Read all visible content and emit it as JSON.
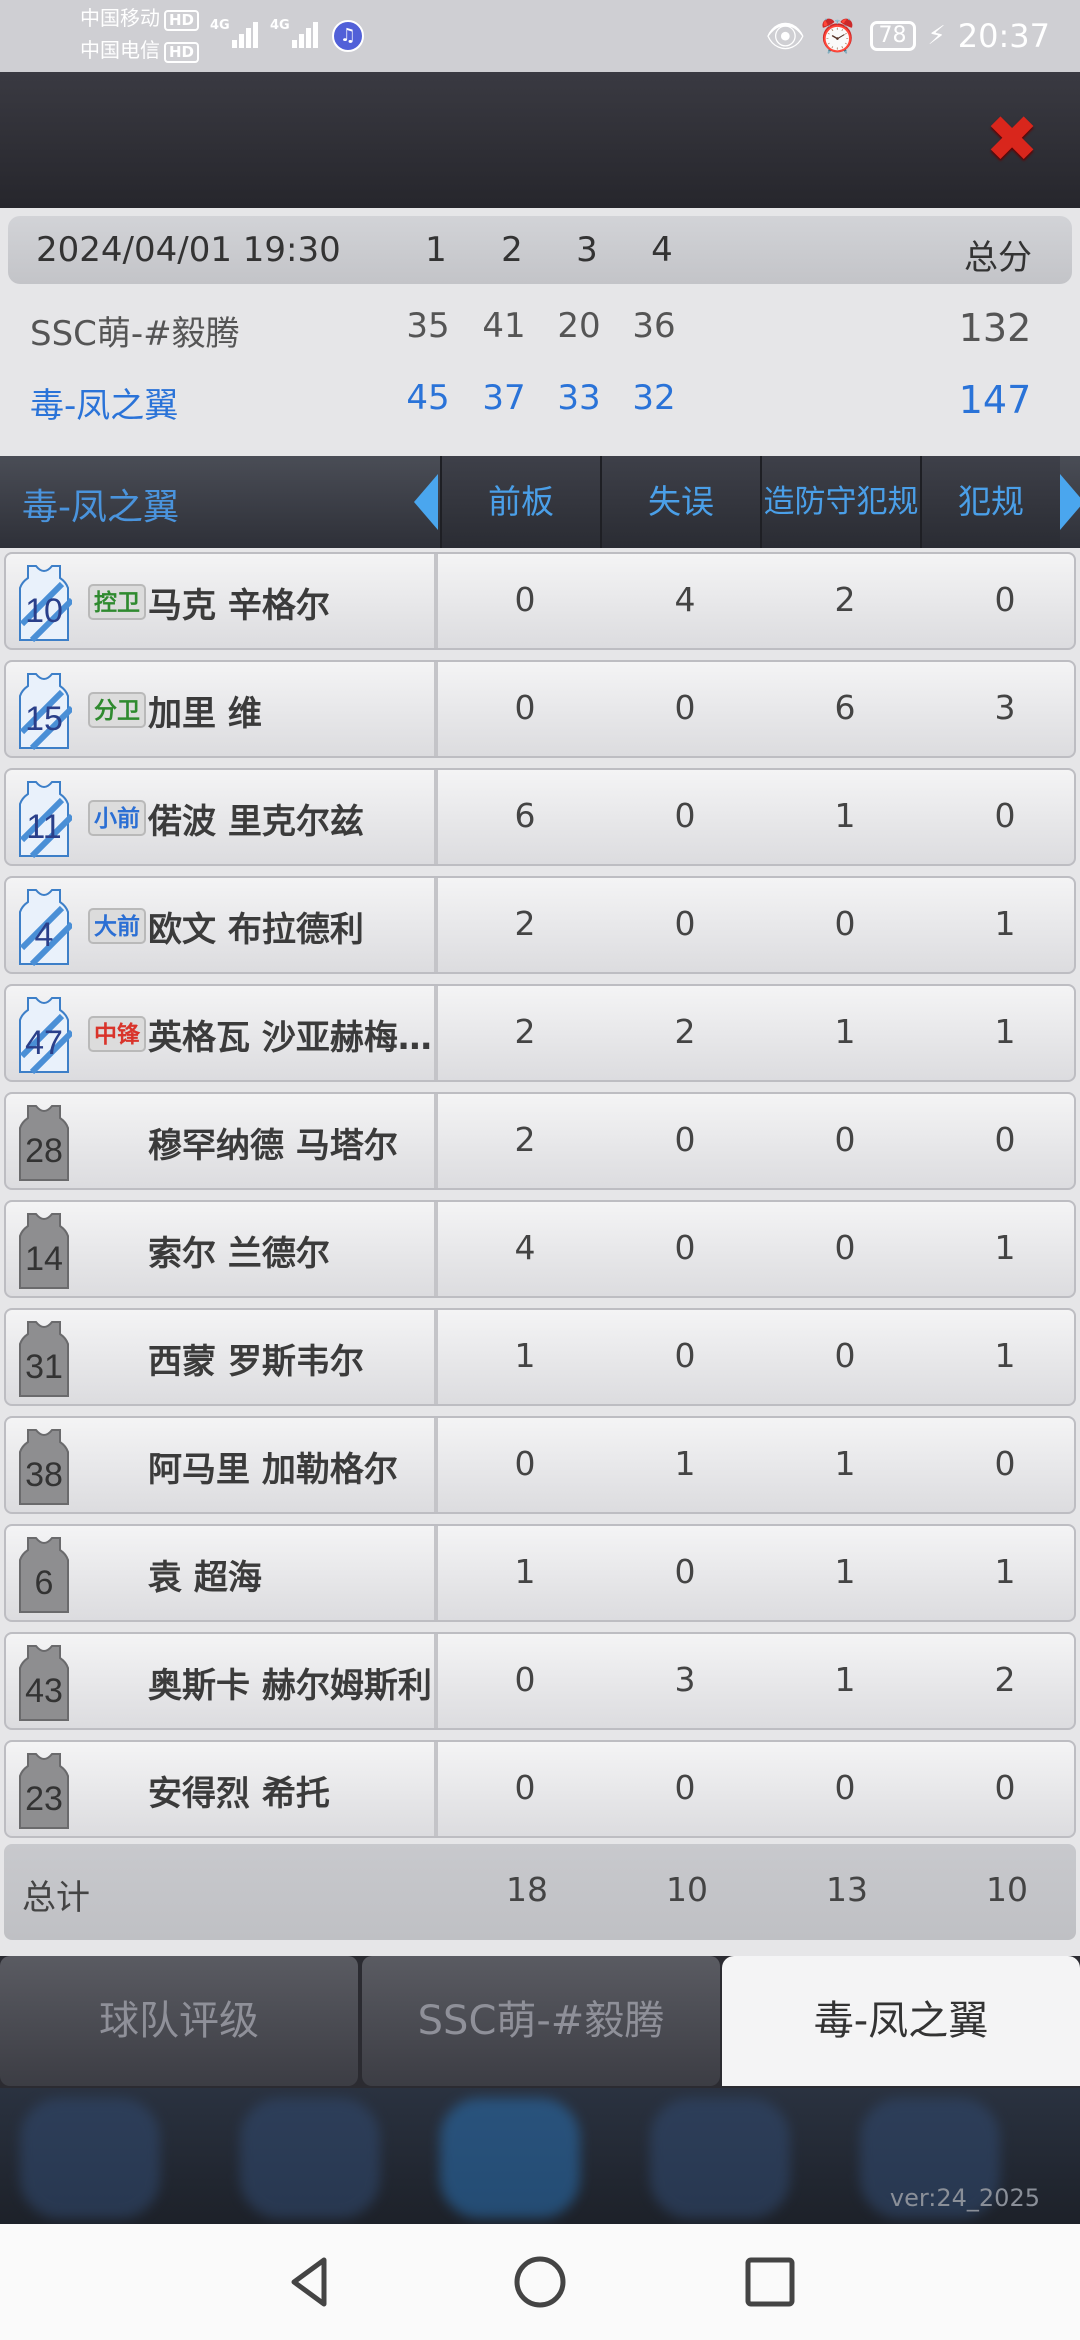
{
  "status": {
    "carrier1": "中国移动",
    "carrier2": "中国电信",
    "hd": "HD",
    "net": "4G",
    "battery": "78",
    "time": "20:37"
  },
  "score": {
    "datetime": "2024/04/01 19:30",
    "quarters": [
      "1",
      "2",
      "3",
      "4"
    ],
    "total_label": "总分",
    "teams": [
      {
        "name": "SSC萌-#毅腾",
        "q": [
          "35",
          "41",
          "20",
          "36"
        ],
        "total": "132",
        "color": "#555555"
      },
      {
        "name": "毒-凤之翼",
        "q": [
          "45",
          "37",
          "33",
          "32"
        ],
        "total": "147",
        "color": "#2a73d8"
      }
    ]
  },
  "stats": {
    "team_name": "毒-凤之翼",
    "columns": [
      "前板",
      "失误",
      "造防守犯规",
      "犯规"
    ],
    "players": [
      {
        "number": "10",
        "pos": "控卫",
        "pos_color": "#2f8a2f",
        "name": "马克 辛格尔",
        "starter": true,
        "vals": [
          "0",
          "4",
          "2",
          "0"
        ]
      },
      {
        "number": "15",
        "pos": "分卫",
        "pos_color": "#2f8a2f",
        "name": "加里 维",
        "starter": true,
        "vals": [
          "0",
          "0",
          "6",
          "3"
        ]
      },
      {
        "number": "11",
        "pos": "小前",
        "pos_color": "#2b6fd4",
        "name": "偌波 里克尔兹",
        "starter": true,
        "vals": [
          "6",
          "0",
          "1",
          "0"
        ]
      },
      {
        "number": "4",
        "pos": "大前",
        "pos_color": "#2b6fd4",
        "name": "欧文 布拉德利",
        "starter": true,
        "vals": [
          "2",
          "0",
          "0",
          "1"
        ]
      },
      {
        "number": "47",
        "pos": "中锋",
        "pos_color": "#d9342b",
        "name": "英格瓦 沙亚赫梅…",
        "starter": true,
        "vals": [
          "2",
          "2",
          "1",
          "1"
        ]
      },
      {
        "number": "28",
        "pos": "",
        "pos_color": "",
        "name": "穆罕纳德 马塔尔",
        "starter": false,
        "vals": [
          "2",
          "0",
          "0",
          "0"
        ]
      },
      {
        "number": "14",
        "pos": "",
        "pos_color": "",
        "name": "索尔 兰德尔",
        "starter": false,
        "vals": [
          "4",
          "0",
          "0",
          "1"
        ]
      },
      {
        "number": "31",
        "pos": "",
        "pos_color": "",
        "name": "西蒙 罗斯韦尔",
        "starter": false,
        "vals": [
          "1",
          "0",
          "0",
          "1"
        ]
      },
      {
        "number": "38",
        "pos": "",
        "pos_color": "",
        "name": "阿马里 加勒格尔",
        "starter": false,
        "vals": [
          "0",
          "1",
          "1",
          "0"
        ]
      },
      {
        "number": "6",
        "pos": "",
        "pos_color": "",
        "name": "袁 超海",
        "starter": false,
        "vals": [
          "1",
          "0",
          "1",
          "1"
        ]
      },
      {
        "number": "43",
        "pos": "",
        "pos_color": "",
        "name": "奥斯卡 赫尔姆斯利",
        "starter": false,
        "vals": [
          "0",
          "3",
          "1",
          "2"
        ]
      },
      {
        "number": "23",
        "pos": "",
        "pos_color": "",
        "name": "安得烈 希托",
        "starter": false,
        "vals": [
          "0",
          "0",
          "0",
          "0"
        ]
      }
    ],
    "total_label": "总计",
    "totals": [
      "18",
      "10",
      "13",
      "10"
    ]
  },
  "tabs": [
    {
      "label": "球队评级",
      "active": false
    },
    {
      "label": "SSC萌-#毅腾",
      "active": false
    },
    {
      "label": "毒-凤之翼",
      "active": true
    }
  ],
  "version": "ver:24_2025",
  "colors": {
    "accent": "#4a9fe8",
    "close": "#d9261c"
  }
}
